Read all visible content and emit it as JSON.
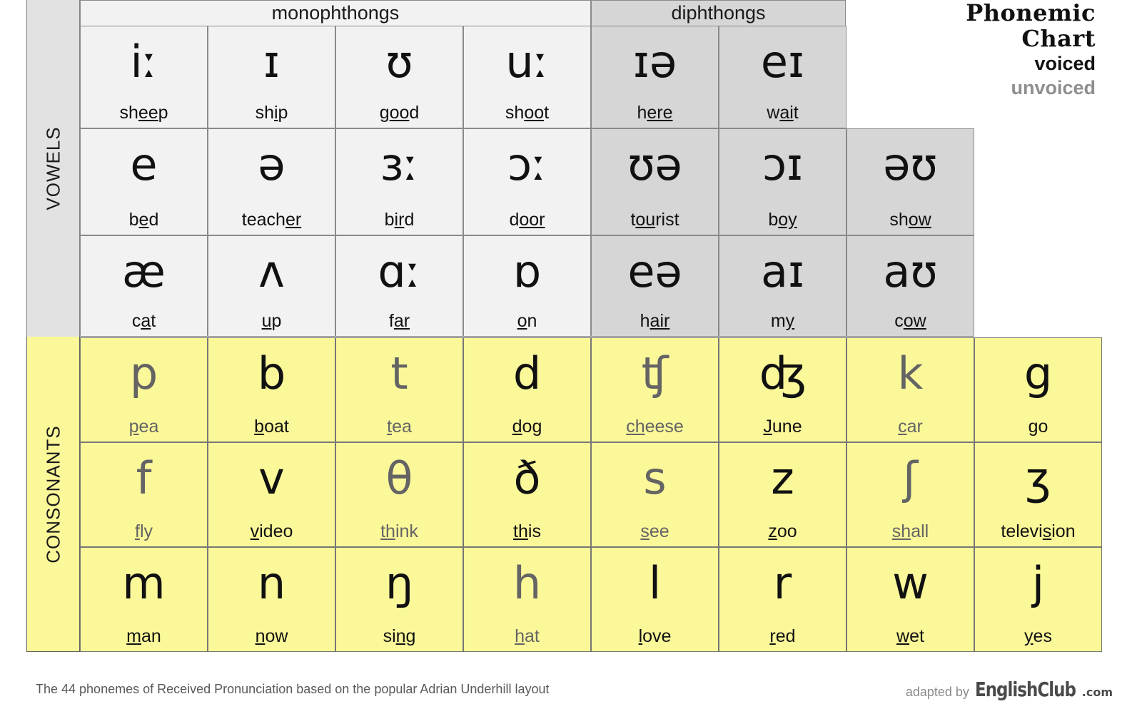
{
  "title": {
    "line1": "Phonemic",
    "line2": "Chart",
    "legend_voiced": "voiced",
    "legend_unvoiced": "unvoiced"
  },
  "sections": {
    "vowels_label": "VOWELS",
    "consonants_label": "CONSONANTS",
    "monophthongs_label": "monophthongs",
    "diphthongs_label": "diphthongs"
  },
  "colors": {
    "monophthong_bg": "#f2f2f2",
    "diphthong_bg": "#d6d6d6",
    "consonant_bg": "#fbf89a",
    "vowels_strip_bg": "#e2e2e2",
    "voiced_text": "#111111",
    "unvoiced_text": "#646464",
    "grid_line": "#8a8a8a"
  },
  "vowels": [
    [
      {
        "symbol": "iː",
        "word_pre": "sh",
        "word_mid": "ee",
        "word_post": "p",
        "group": "monophthong"
      },
      {
        "symbol": "ɪ",
        "word_pre": "sh",
        "word_mid": "i",
        "word_post": "p",
        "group": "monophthong"
      },
      {
        "symbol": "ʊ",
        "word_pre": "g",
        "word_mid": "oo",
        "word_post": "d",
        "group": "monophthong"
      },
      {
        "symbol": "uː",
        "word_pre": "sh",
        "word_mid": "oo",
        "word_post": "t",
        "group": "monophthong"
      },
      {
        "symbol": "ɪə",
        "word_pre": "h",
        "word_mid": "ere",
        "word_post": "",
        "group": "diphthong"
      },
      {
        "symbol": "eɪ",
        "word_pre": "w",
        "word_mid": "ai",
        "word_post": "t",
        "group": "diphthong"
      },
      null
    ],
    [
      {
        "symbol": "e",
        "word_pre": "b",
        "word_mid": "e",
        "word_post": "d",
        "group": "monophthong"
      },
      {
        "symbol": "ə",
        "word_pre": "teach",
        "word_mid": "er",
        "word_post": "",
        "group": "monophthong"
      },
      {
        "symbol": "ɜː",
        "word_pre": "b",
        "word_mid": "ir",
        "word_post": "d",
        "group": "monophthong"
      },
      {
        "symbol": "ɔː",
        "word_pre": "d",
        "word_mid": "oor",
        "word_post": "",
        "group": "monophthong"
      },
      {
        "symbol": "ʊə",
        "word_pre": "t",
        "word_mid": "ou",
        "word_post": "rist",
        "group": "diphthong"
      },
      {
        "symbol": "ɔɪ",
        "word_pre": "b",
        "word_mid": "oy",
        "word_post": "",
        "group": "diphthong"
      },
      {
        "symbol": "əʊ",
        "word_pre": "sh",
        "word_mid": "ow",
        "word_post": "",
        "group": "diphthong"
      }
    ],
    [
      {
        "symbol": "æ",
        "word_pre": "c",
        "word_mid": "a",
        "word_post": "t",
        "group": "monophthong"
      },
      {
        "symbol": "ʌ",
        "word_pre": "",
        "word_mid": "u",
        "word_post": "p",
        "group": "monophthong"
      },
      {
        "symbol": "ɑː",
        "word_pre": "f",
        "word_mid": "ar",
        "word_post": "",
        "group": "monophthong"
      },
      {
        "symbol": "ɒ",
        "word_pre": "",
        "word_mid": "o",
        "word_post": "n",
        "group": "monophthong"
      },
      {
        "symbol": "eə",
        "word_pre": "h",
        "word_mid": "air",
        "word_post": "",
        "group": "diphthong"
      },
      {
        "symbol": "aɪ",
        "word_pre": "m",
        "word_mid": "y",
        "word_post": "",
        "group": "diphthong"
      },
      {
        "symbol": "aʊ",
        "word_pre": "c",
        "word_mid": "ow",
        "word_post": "",
        "group": "diphthong"
      }
    ]
  ],
  "consonants": [
    [
      {
        "symbol": "p",
        "word_pre": "",
        "word_mid": "p",
        "word_post": "ea",
        "voicing": "unvoiced"
      },
      {
        "symbol": "b",
        "word_pre": "",
        "word_mid": "b",
        "word_post": "oat",
        "voicing": "voiced"
      },
      {
        "symbol": "t",
        "word_pre": "",
        "word_mid": "t",
        "word_post": "ea",
        "voicing": "unvoiced"
      },
      {
        "symbol": "d",
        "word_pre": "",
        "word_mid": "d",
        "word_post": "og",
        "voicing": "voiced"
      },
      {
        "symbol": "ʧ",
        "word_pre": "",
        "word_mid": "ch",
        "word_post": "eese",
        "voicing": "unvoiced"
      },
      {
        "symbol": "ʤ",
        "word_pre": "",
        "word_mid": "J",
        "word_post": "une",
        "voicing": "voiced"
      },
      {
        "symbol": "k",
        "word_pre": "",
        "word_mid": "c",
        "word_post": "ar",
        "voicing": "unvoiced"
      },
      {
        "symbol": "g",
        "word_pre": "",
        "word_mid": "g",
        "word_post": "o",
        "voicing": "voiced"
      }
    ],
    [
      {
        "symbol": "f",
        "word_pre": "",
        "word_mid": "f",
        "word_post": "ly",
        "voicing": "unvoiced"
      },
      {
        "symbol": "v",
        "word_pre": "",
        "word_mid": "v",
        "word_post": "ideo",
        "voicing": "voiced"
      },
      {
        "symbol": "θ",
        "word_pre": "",
        "word_mid": "th",
        "word_post": "ink",
        "voicing": "unvoiced"
      },
      {
        "symbol": "ð",
        "word_pre": "",
        "word_mid": "th",
        "word_post": "is",
        "voicing": "voiced"
      },
      {
        "symbol": "s",
        "word_pre": "",
        "word_mid": "s",
        "word_post": "ee",
        "voicing": "unvoiced"
      },
      {
        "symbol": "z",
        "word_pre": "",
        "word_mid": "z",
        "word_post": "oo",
        "voicing": "voiced"
      },
      {
        "symbol": "ʃ",
        "word_pre": "",
        "word_mid": "sh",
        "word_post": "all",
        "voicing": "unvoiced"
      },
      {
        "symbol": "ʒ",
        "word_pre": "televi",
        "word_mid": "s",
        "word_post": "ion",
        "voicing": "voiced"
      }
    ],
    [
      {
        "symbol": "m",
        "word_pre": "",
        "word_mid": "m",
        "word_post": "an",
        "voicing": "voiced"
      },
      {
        "symbol": "n",
        "word_pre": "",
        "word_mid": "n",
        "word_post": "ow",
        "voicing": "voiced"
      },
      {
        "symbol": "ŋ",
        "word_pre": "si",
        "word_mid": "ng",
        "word_post": "",
        "voicing": "voiced"
      },
      {
        "symbol": "h",
        "word_pre": "",
        "word_mid": "h",
        "word_post": "at",
        "voicing": "unvoiced"
      },
      {
        "symbol": "l",
        "word_pre": "",
        "word_mid": "l",
        "word_post": "ove",
        "voicing": "voiced"
      },
      {
        "symbol": "r",
        "word_pre": "",
        "word_mid": "r",
        "word_post": "ed",
        "voicing": "voiced"
      },
      {
        "symbol": "w",
        "word_pre": "",
        "word_mid": "w",
        "word_post": "et",
        "voicing": "voiced"
      },
      {
        "symbol": "j",
        "word_pre": "",
        "word_mid": "y",
        "word_post": "es",
        "voicing": "voiced"
      }
    ]
  ],
  "footer": {
    "note": "The 44 phonemes of Received Pronunciation based on the popular Adrian Underhill layout",
    "adapted_by": "adapted by",
    "brand": "EnglishClub",
    "brand_tld": ".com"
  }
}
